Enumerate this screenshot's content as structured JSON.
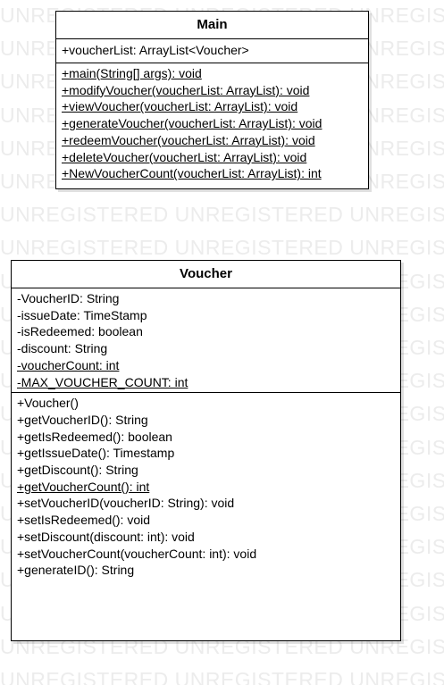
{
  "watermark": {
    "text": "UNREGISTERED UNREGISTERED UNREGISTERED",
    "rows": 21
  },
  "classes": [
    {
      "id": "class-main",
      "name": "Main",
      "attributes": [
        {
          "text": "+voucherList: ArrayList<Voucher>",
          "static": false
        }
      ],
      "operations": [
        {
          "text": "+main(String[] args): void",
          "static": true
        },
        {
          "text": "+modifyVoucher(voucherList: ArrayList): void",
          "static": true
        },
        {
          "text": "+viewVoucher(voucherList: ArrayList): void",
          "static": true
        },
        {
          "text": "+generateVoucher(voucherList: ArrayList): void",
          "static": true
        },
        {
          "text": "+redeemVoucher(voucherList: ArrayList): void",
          "static": true
        },
        {
          "text": "+deleteVoucher(voucherList: ArrayList): void",
          "static": true
        },
        {
          "text": "+NewVoucherCount(voucherList: ArrayList): int",
          "static": true
        }
      ]
    },
    {
      "id": "class-voucher",
      "name": "Voucher",
      "attributes": [
        {
          "text": "-VoucherID: String",
          "static": false
        },
        {
          "text": "-issueDate: TimeStamp",
          "static": false
        },
        {
          "text": "-isRedeemed: boolean",
          "static": false
        },
        {
          "text": "-discount: String",
          "static": false
        },
        {
          "text": "-voucherCount: int",
          "static": true
        },
        {
          "text": "-MAX_VOUCHER_COUNT: int",
          "static": true
        }
      ],
      "operations": [
        {
          "text": "+Voucher()",
          "static": false
        },
        {
          "text": "+getVoucherID(): String",
          "static": false
        },
        {
          "text": "+getIsRedeemed(): boolean",
          "static": false
        },
        {
          "text": "+getIssueDate(): Timestamp",
          "static": false
        },
        {
          "text": "+getDiscount(): String",
          "static": false
        },
        {
          "text": "+getVoucherCount(): int",
          "static": true
        },
        {
          "text": "+setVoucherID(voucherID: String): void",
          "static": false
        },
        {
          "text": "+setIsRedeemed(): void",
          "static": false
        },
        {
          "text": "+setDiscount(discount: int): void",
          "static": false
        },
        {
          "text": "+setVoucherCount(voucherCount: int): void",
          "static": false
        },
        {
          "text": "+generateID(): String",
          "static": false
        }
      ]
    }
  ]
}
